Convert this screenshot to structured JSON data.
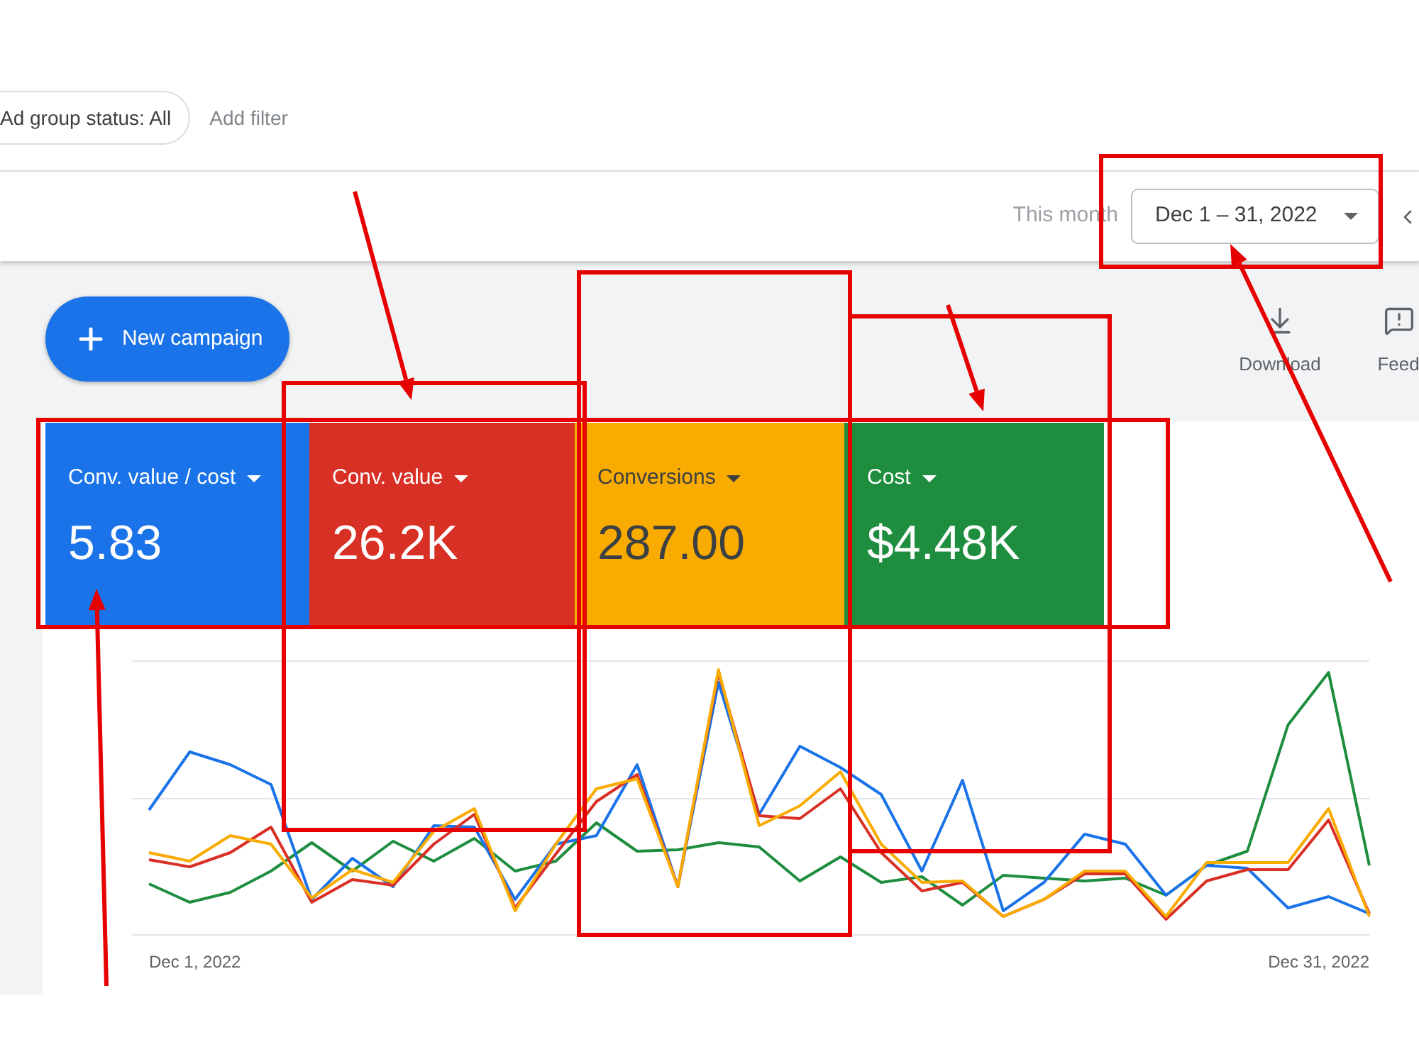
{
  "filters": {
    "chips": [
      {
        "label": "Ad group status: All"
      }
    ],
    "add_filter": "Add filter"
  },
  "date_range": {
    "preset": "This month",
    "value": "Dec 1 – 31, 2022"
  },
  "toolbar": {
    "new_campaign": "New campaign",
    "actions": [
      {
        "label": "Download",
        "kind": "download"
      },
      {
        "label": "Feed",
        "kind": "feedback"
      }
    ]
  },
  "metrics": [
    {
      "label": "Conv. value / cost",
      "value": "5.83",
      "color": "#1a73e8"
    },
    {
      "label": "Conv. value",
      "value": "26.2K",
      "color": "#d93025"
    },
    {
      "label": "Conversions",
      "value": "287.00",
      "color": "#f9ab00"
    },
    {
      "label": "Cost",
      "value": "$4.48K",
      "color": "#1e8e3e"
    }
  ],
  "chart": {
    "x_start": "Dec 1, 2022",
    "x_end": "Dec 31, 2022"
  }
}
